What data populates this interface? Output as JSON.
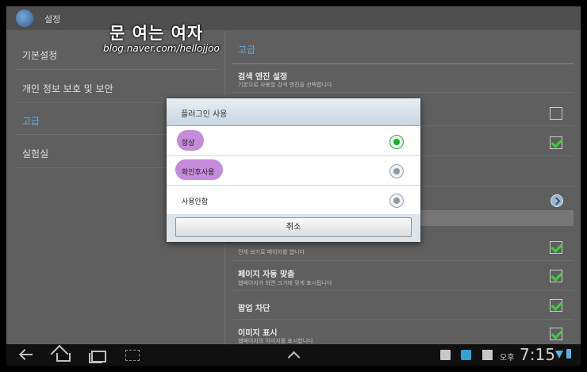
{
  "actionbar": {
    "title": "설정"
  },
  "watermark": {
    "title": "문 여는 여자",
    "url": "blog.naver.com/hellojjoo"
  },
  "left_menu": [
    {
      "label": "기본설정",
      "active": false
    },
    {
      "label": "개인 정보 보호 및 보안",
      "active": false
    },
    {
      "label": "고급",
      "active": true
    },
    {
      "label": "실험실",
      "active": false
    }
  ],
  "right": {
    "section": "고급",
    "search_engine": {
      "title": "검색 엔진 설정",
      "sub": "기본으로 사용할 검색 엔진을 선택합니다"
    },
    "overview": {
      "sub": "전체 보기로 페이지를 엽니다"
    },
    "autofit": {
      "title": "페이지 자동 맞춤",
      "sub": "웹페이지가 화면 크기에 맞게 표시됩니다"
    },
    "popup": {
      "title": "팝업 차단"
    },
    "images": {
      "title": "이미지 표시",
      "sub": "웹페이지의 이미지를 표시합니다"
    }
  },
  "dialog": {
    "title": "플러그인 사용",
    "options": [
      {
        "label": "항상",
        "selected": true
      },
      {
        "label": "확인후사용",
        "selected": false
      },
      {
        "label": "사용안함",
        "selected": false
      }
    ],
    "cancel": "취소"
  },
  "statusbar": {
    "ampm": "오후",
    "time": "7:15"
  },
  "icons": {
    "app": "browser-globe-icon",
    "back": "back-icon",
    "home": "home-icon",
    "recent": "recent-apps-icon",
    "screenshot": "screenshot-icon",
    "up": "chevron-up-icon",
    "mail": "email-icon",
    "twitter": "twitter-icon",
    "gmail": "gmail-icon",
    "wifi": "wifi-icon",
    "battery": "battery-icon"
  },
  "colors": {
    "accent": "#6aa5d6",
    "check": "#3ccf3c",
    "radio_on": "#19b019",
    "highlight": "#c68adb"
  }
}
